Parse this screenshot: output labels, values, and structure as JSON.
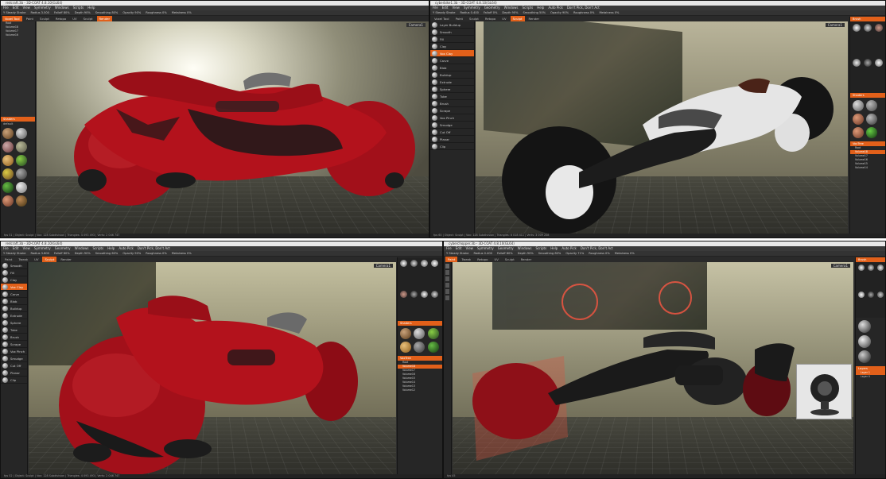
{
  "windows": {
    "tl": {
      "title": "redcraft.3b - 3D-COAT 4.8.10(GL64)",
      "menu": [
        "File",
        "Edit",
        "View",
        "Symmetry",
        "Windows",
        "Scripts",
        "Help"
      ],
      "toolbar": [
        "Y Steady Stroke",
        "Radius 3.500",
        "Falloff 80%",
        "Depth 90%",
        "Smoothing 80%",
        "Opacity 90%",
        "Roughness 0%",
        "Metalness 0%"
      ],
      "tabs": [
        {
          "label": "Voxel Tool",
          "active": true
        },
        {
          "label": "Paint",
          "active": false
        },
        {
          "label": "Sculpt",
          "active": false
        },
        {
          "label": "Retopo",
          "active": false
        },
        {
          "label": "UV",
          "active": false
        },
        {
          "label": "Sculpt",
          "active": false
        },
        {
          "label": "Render",
          "active": true
        }
      ],
      "camera": "Camera1",
      "status": "fps 51 | Object: Sculpt | Vox: 128 Subdivision | Triangles: 4 093 493 | Verts: 2 046 747",
      "model_color": "#b3121c"
    },
    "tr": {
      "title": "cyberbike1.3b - 3D-COAT 4.8.10(GL64)",
      "menu": [
        "File",
        "Edit",
        "View",
        "Symmetry",
        "Geometry",
        "Windows",
        "Scripts",
        "Help",
        "Auto Pick",
        "Don't Pick, Don't Act"
      ],
      "toolbar": [
        "Y Steady Stroke",
        "Radius 0.400",
        "Falloff 0%",
        "Depth 90%",
        "Smoothing 50%",
        "Opacity 90%",
        "Roughness 0%",
        "Metalness 0%"
      ],
      "tabs": [
        {
          "label": "Voxel Tool",
          "active": false
        },
        {
          "label": "Paint",
          "active": false
        },
        {
          "label": "Sculpt",
          "active": false
        },
        {
          "label": "Retopo",
          "active": false
        },
        {
          "label": "UV",
          "active": false
        },
        {
          "label": "Sculpt",
          "active": true
        },
        {
          "label": "Render",
          "active": false
        }
      ],
      "camera": "Camera1",
      "status": "fps 60 | Object: Sculpt | Vox: 128 Subdivision | Triangles: 6 018 411 | Verts: 3 009 208",
      "model_color": "#e5e5e5"
    },
    "bl": {
      "title": "redcraft.3b - 3D-COAT 4.8.10(GL64)",
      "menu": [
        "File",
        "Edit",
        "View",
        "Symmetry",
        "Geometry",
        "Windows",
        "Scripts",
        "Help",
        "Auto Pick",
        "Don't Pick, Don't Act"
      ],
      "toolbar": [
        "Y Steady Stroke",
        "Radius 3.800",
        "Falloff 80%",
        "Depth 90%",
        "Smoothing 60%",
        "Opacity 90%",
        "Roughness 0%",
        "Metalness 0%"
      ],
      "tabs": [
        {
          "label": "Paint",
          "active": false
        },
        {
          "label": "Tweak",
          "active": false
        },
        {
          "label": "UV",
          "active": false
        },
        {
          "label": "Sculpt",
          "active": true
        },
        {
          "label": "Render",
          "active": false
        }
      ],
      "camera": "Camera1",
      "status": "fps 52 | Object: Sculpt | Vox: 128 Subdivision | Triangles: 4 093 493 | Verts: 2 046 747",
      "model_color": "#b3121c"
    },
    "br": {
      "title": "cyberchopper.3b - 3D-COAT 4.8.10(GL64)",
      "menu": [
        "File",
        "Edit",
        "View",
        "Symmetry",
        "Geometry",
        "Windows",
        "Scripts",
        "Help",
        "Auto Pick",
        "Don't Pick, Don't Act"
      ],
      "toolbar": [
        "Y Steady Stroke",
        "Radius 0.400",
        "Falloff 80%",
        "Depth 90%",
        "Smoothing 80%",
        "Opacity 71%",
        "Roughness 0%",
        "Metalness 0%"
      ],
      "tabs": [
        {
          "label": "Paint",
          "active": true
        },
        {
          "label": "Tweak",
          "active": false
        },
        {
          "label": "Retopo",
          "active": false
        },
        {
          "label": "UV",
          "active": false
        },
        {
          "label": "Sculpt",
          "active": false
        },
        {
          "label": "Render",
          "active": false
        }
      ],
      "camera": "Camera1",
      "status": "fps 45",
      "model_color": "#1e1e1e"
    }
  },
  "brushes": [
    "Layer Buildup",
    "Smooth",
    "Fill",
    "Clay",
    "Vox Clay",
    "Carve",
    "Blob",
    "Buildup",
    "Extrude",
    "Sphere",
    "Tube",
    "Brush",
    "Scrape",
    "Vox Pinch",
    "Smudge",
    "Cut Off",
    "Planar",
    "Clip",
    "Fill",
    "Flatten",
    "Snake"
  ],
  "active_brush": "Vox Clay",
  "shaders_label": "Shaders",
  "default_label": "default",
  "layers_label": "VoxTree",
  "layers": [
    "Root",
    "Volume18",
    "Volume17",
    "Volume16",
    "Volume15",
    "Volume14",
    "Volume13",
    "Volume12"
  ],
  "layer_panel": {
    "title": "Layers",
    "items": [
      "Layer 1",
      "Layer 0"
    ]
  },
  "colors": {
    "accent": "#e2601a",
    "bg": "#2b2b2b"
  }
}
